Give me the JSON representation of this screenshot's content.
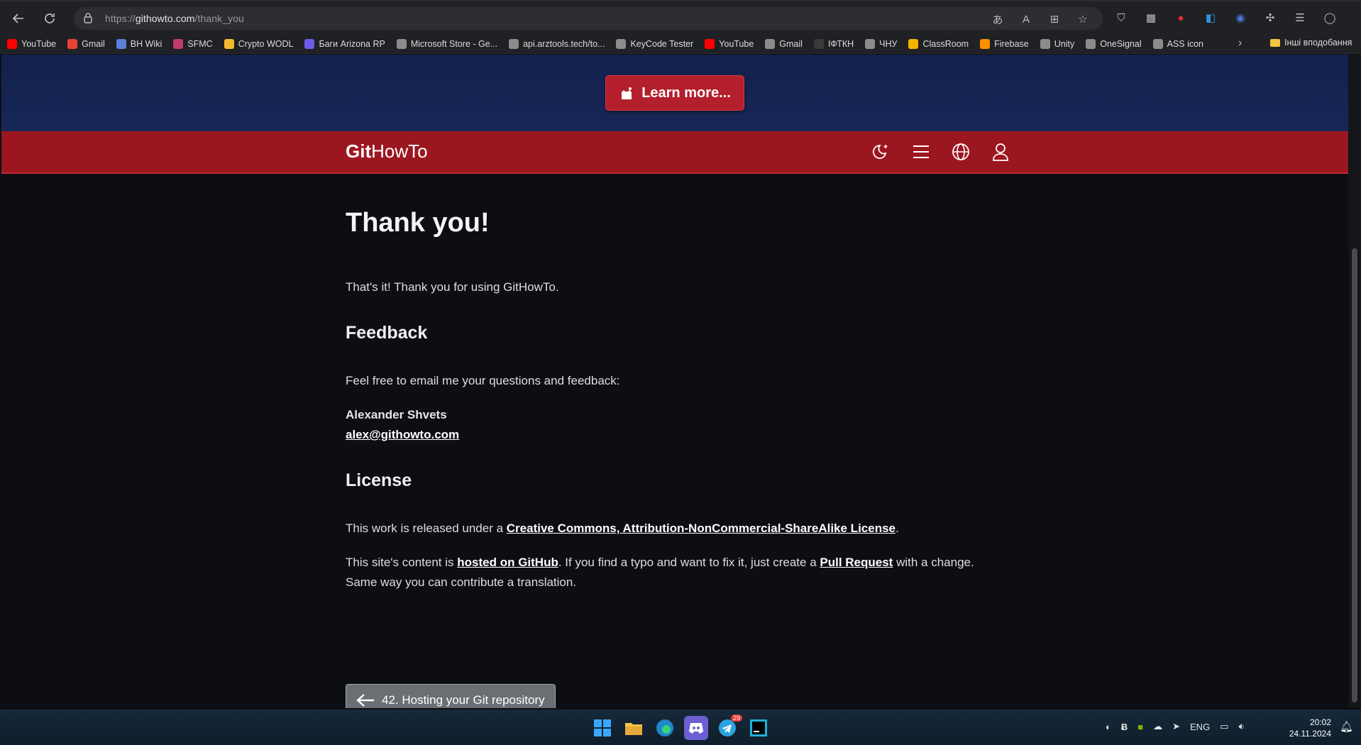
{
  "browser": {
    "url_prefix": "https://",
    "url_domain": "githowto.com",
    "url_path": "/thank_you",
    "bookmarks": [
      {
        "label": "YouTube",
        "color": "#ff0000"
      },
      {
        "label": "Gmail",
        "color": "#ea4335"
      },
      {
        "label": "BH Wiki",
        "color": "#5a7fd6"
      },
      {
        "label": "SFMC",
        "color": "#c23b6b"
      },
      {
        "label": "Crypto WODL",
        "color": "#f3ba2f"
      },
      {
        "label": "Баги Arizona RP",
        "color": "#6c5ce7"
      },
      {
        "label": "Microsoft Store - Ge...",
        "color": "#8c8c8c"
      },
      {
        "label": "api.arztools.tech/to...",
        "color": "#8c8c8c"
      },
      {
        "label": "KeyCode Tester",
        "color": "#8c8c8c"
      },
      {
        "label": "YouTube",
        "color": "#ff0000"
      },
      {
        "label": "Gmail",
        "color": "#8c8c8c"
      },
      {
        "label": "ІФТКН",
        "color": "#3a3a3a"
      },
      {
        "label": "ЧНУ",
        "color": "#8c8c8c"
      },
      {
        "label": "ClassRoom",
        "color": "#f5b400"
      },
      {
        "label": "Firebase",
        "color": "#ff9100"
      },
      {
        "label": "Unity",
        "color": "#8c8c8c"
      },
      {
        "label": "OneSignal",
        "color": "#8c8c8c"
      },
      {
        "label": "ASS icon",
        "color": "#8c8c8c"
      }
    ],
    "other_bookmarks": "Інші вподобання"
  },
  "banner": {
    "learn_more": "Learn more..."
  },
  "header": {
    "logo_bold": "Git",
    "logo_rest": "HowTo"
  },
  "content": {
    "title": "Thank you!",
    "intro": "That's it! Thank you for using GitHowTo.",
    "feedback_heading": "Feedback",
    "feedback_text": "Feel free to email me your questions and feedback:",
    "author_name": "Alexander Shvets",
    "author_email": "alex@githowto.com",
    "license_heading": "License",
    "license_prefix": "This work is released under a ",
    "license_link": "Creative Commons, Attribution-NonCommercial-ShareAlike License",
    "license_suffix": ".",
    "hosted_prefix": "This site's content is ",
    "hosted_link": "hosted on GitHub",
    "hosted_middle": ". If you find a typo and want to fix it, just create a ",
    "pr_link": "Pull Request",
    "hosted_suffix": " with a change. Same way you can contribute a translation.",
    "prev_button": "42. Hosting your Git repository"
  },
  "taskbar": {
    "telegram_badge": "29",
    "lang": "ENG",
    "time": "20:02",
    "date": "24.11.2024"
  },
  "colors": {
    "banner": "#172657",
    "header": "#9c1620",
    "accent": "#b31f2c",
    "page_bg": "#0c0e13"
  }
}
